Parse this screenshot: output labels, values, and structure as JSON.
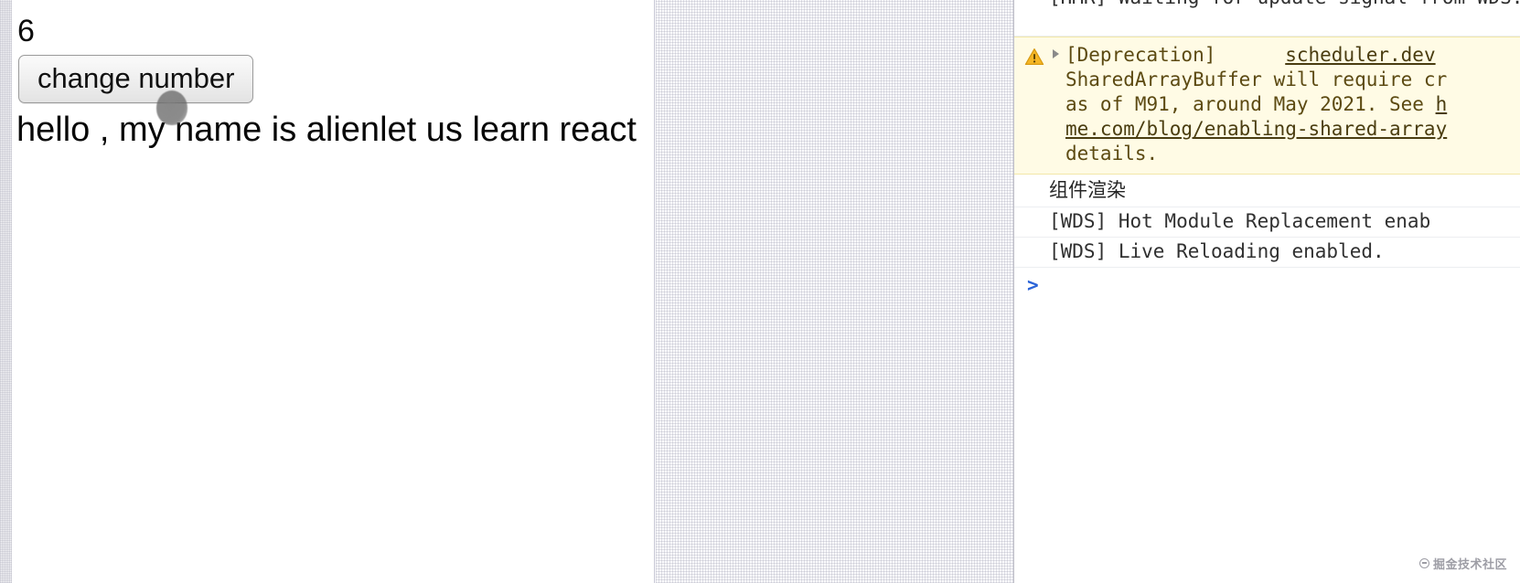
{
  "app": {
    "counter_value": "6",
    "change_number_label": "change number",
    "greeting": "hello , my name is alienlet us learn react"
  },
  "cursor": {
    "name": "mouse-pointer-blob"
  },
  "devtools": {
    "console_rows": [
      {
        "id": "hmr",
        "type": "log",
        "text": "[HMR] Waiting for update signal from WDS...",
        "clipped_top": true
      },
      {
        "id": "warning",
        "type": "warning",
        "icon": "warning-triangle-icon",
        "disclosure": "disclosure-triangle-collapsed",
        "prefix": "[Deprecation]",
        "link_label": "scheduler.dev",
        "body_line_2": "SharedArrayBuffer will require cr",
        "body_line_3": "as of M91, around May 2021. See ",
        "body_line_3_link": "h",
        "body_line_4_link": "me.com/blog/enabling-shared-array",
        "body_line_5": "details."
      },
      {
        "id": "component-render",
        "type": "log",
        "text": "组件渲染"
      },
      {
        "id": "wds-hmr",
        "type": "log",
        "text": "[WDS] Hot Module Replacement enab"
      },
      {
        "id": "wds-live",
        "type": "log",
        "text": "[WDS] Live Reloading enabled."
      }
    ],
    "prompt_arrow": ">",
    "prompt_value": ""
  },
  "watermark": {
    "text": "掘金技术社区"
  },
  "colors": {
    "warning_bg": "#fffbe5",
    "warning_border": "#f2e7a8",
    "warning_icon": "#f5a623",
    "prompt_blue": "#2a63d8",
    "page_bg": "#ffffff",
    "chrome_bg": "#fafafc"
  }
}
